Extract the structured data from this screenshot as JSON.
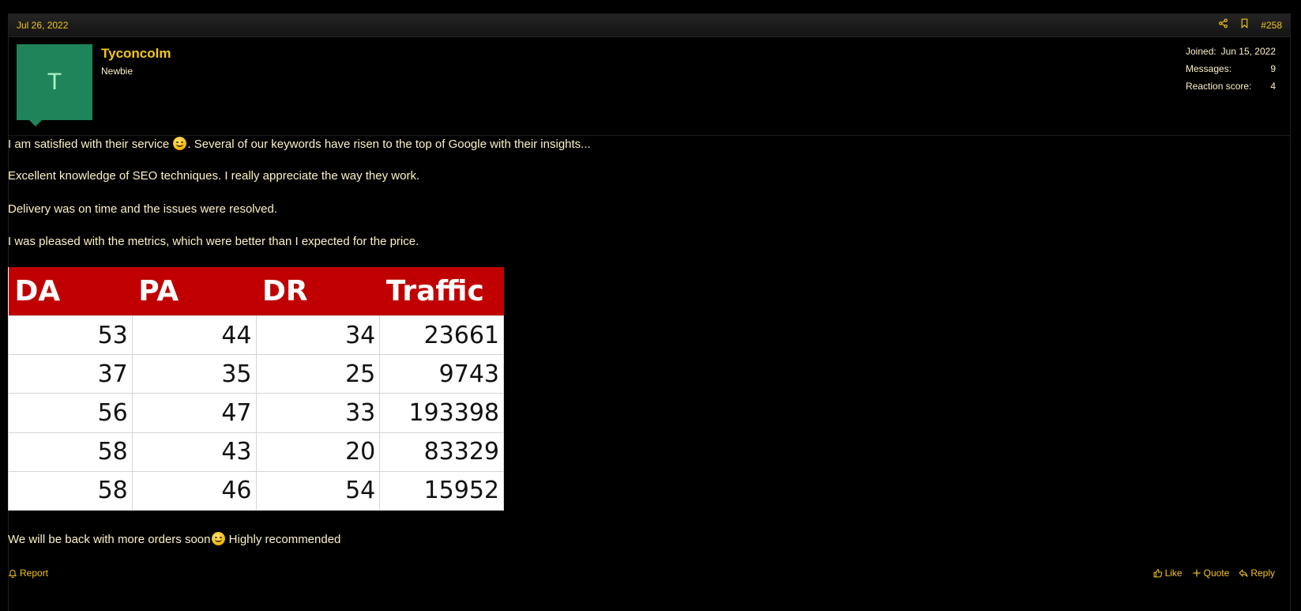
{
  "post": {
    "date": "Jul 26, 2022",
    "number": "#258",
    "share_icon": "share-icon",
    "bookmark_icon": "bookmark-icon"
  },
  "user": {
    "avatar_letter": "T",
    "avatar_color": "#1f845a",
    "name": "Tyconcolm",
    "title": "Newbie",
    "stats": [
      {
        "label": "Joined:",
        "value": "Jun 15, 2022"
      },
      {
        "label": "Messages:",
        "value": "9"
      },
      {
        "label": "Reaction score:",
        "value": "4"
      }
    ]
  },
  "message": {
    "p1_before": "I am satisfied with their service ",
    "p1_after": ". Several of our keywords have risen to the top of Google with their insights...",
    "p2": "Excellent knowledge of SEO techniques. I really appreciate the way they work.",
    "p3": "Delivery was on time and the issues were resolved.",
    "p4": "I was pleased with the metrics, which were better than I expected for the price.",
    "p5_before": "We will be back with more orders soon",
    "p5_after": " Highly recommended"
  },
  "metrics_table": {
    "headers": [
      "DA",
      "PA",
      "DR",
      "Traffic"
    ],
    "rows": [
      [
        "53",
        "44",
        "34",
        "23661"
      ],
      [
        "37",
        "35",
        "25",
        "9743"
      ],
      [
        "56",
        "47",
        "33",
        "193398"
      ],
      [
        "58",
        "43",
        "20",
        "83329"
      ],
      [
        "58",
        "46",
        "54",
        "15952"
      ]
    ]
  },
  "actions": {
    "report": "Report",
    "like": "Like",
    "quote": "Quote",
    "reply": "Reply"
  },
  "colors": {
    "accent": "#f5c518",
    "text": "#fdf2c6",
    "table_header": "#c00000"
  }
}
